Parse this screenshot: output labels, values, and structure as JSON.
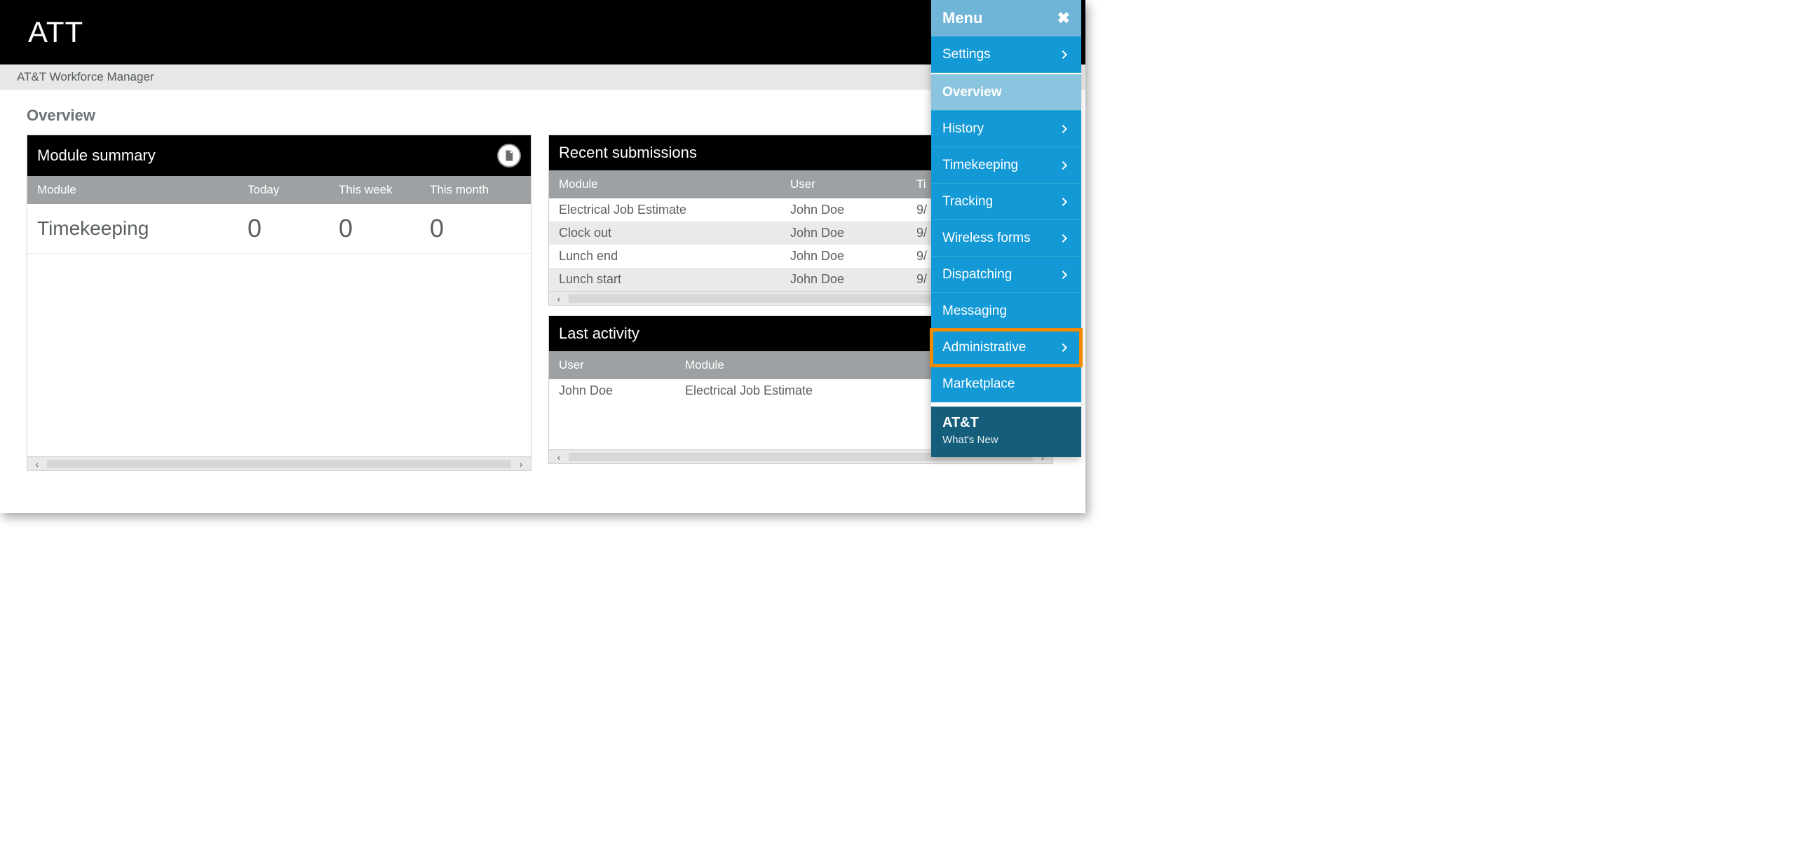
{
  "banner": {
    "logo_text": "ATT"
  },
  "breadcrumb": {
    "label": "AT&T Workforce Manager"
  },
  "page": {
    "title": "Overview"
  },
  "module_summary": {
    "title": "Module summary",
    "columns": {
      "module": "Module",
      "today": "Today",
      "week": "This week",
      "month": "This month"
    },
    "rows": [
      {
        "module": "Timekeeping",
        "today": "0",
        "week": "0",
        "month": "0"
      }
    ]
  },
  "recent_submissions": {
    "title": "Recent submissions",
    "columns": {
      "module": "Module",
      "user": "User",
      "time": "Ti"
    },
    "rows": [
      {
        "module": "Electrical Job Estimate",
        "user": "John Doe",
        "time": "9/"
      },
      {
        "module": "Clock out",
        "user": "John Doe",
        "time": "9/"
      },
      {
        "module": "Lunch end",
        "user": "John Doe",
        "time": "9/"
      },
      {
        "module": "Lunch start",
        "user": "John Doe",
        "time": "9/"
      }
    ]
  },
  "last_activity": {
    "title": "Last activity",
    "columns": {
      "user": "User",
      "module": "Module"
    },
    "rows": [
      {
        "user": "John Doe",
        "module": "Electrical Job Estimate"
      }
    ]
  },
  "side_menu": {
    "header": "Menu",
    "items": [
      {
        "label": "Settings",
        "chevron": true
      },
      {
        "label": "Overview",
        "chevron": false,
        "current": true
      },
      {
        "label": "History",
        "chevron": true
      },
      {
        "label": "Timekeeping",
        "chevron": true
      },
      {
        "label": "Tracking",
        "chevron": true
      },
      {
        "label": "Wireless forms",
        "chevron": true
      },
      {
        "label": "Dispatching",
        "chevron": true
      },
      {
        "label": "Messaging",
        "chevron": false
      },
      {
        "label": "Administrative",
        "chevron": true,
        "highlight": true
      },
      {
        "label": "Marketplace",
        "chevron": false
      }
    ],
    "footer": {
      "line1": "AT&T",
      "line2": "What's New"
    }
  }
}
